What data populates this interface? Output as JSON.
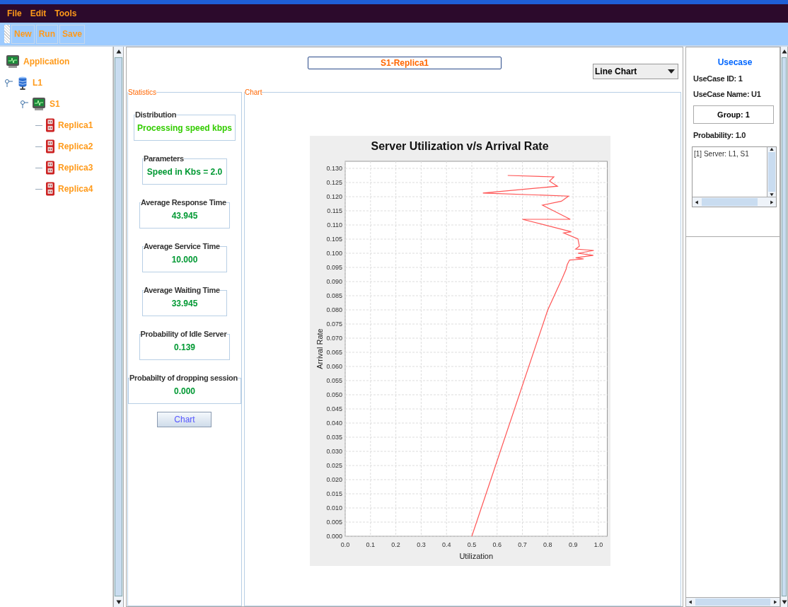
{
  "menu": [
    "File",
    "Edit",
    "Tools"
  ],
  "toolbar": [
    "New",
    "Run",
    "Save"
  ],
  "tree": {
    "label": "Application",
    "kind": "app",
    "children": [
      {
        "label": "L1",
        "kind": "server",
        "expanded": true,
        "children": [
          {
            "label": "S1",
            "kind": "app",
            "expanded": true,
            "children": [
              {
                "label": "Replica1",
                "kind": "replica"
              },
              {
                "label": "Replica2",
                "kind": "replica"
              },
              {
                "label": "Replica3",
                "kind": "replica"
              },
              {
                "label": "Replica4",
                "kind": "replica"
              }
            ]
          }
        ]
      }
    ]
  },
  "selector": {
    "value": "S1-Replica1"
  },
  "chart_type": {
    "value": "Line Chart"
  },
  "statistics": {
    "title": "Statistics",
    "groups": [
      {
        "title": "Distribution",
        "value": "Processing speed kbps",
        "color": "#33cc00"
      },
      {
        "title": "Parameters",
        "value": "Speed in Kbs = 2.0",
        "color": "#009933"
      },
      {
        "title": "Average Response Time",
        "value": "43.945",
        "color": "#009933"
      },
      {
        "title": "Average Service Time",
        "value": "10.000",
        "color": "#009933"
      },
      {
        "title": "Average Waiting Time",
        "value": "33.945",
        "color": "#009933"
      },
      {
        "title": "Probability of Idle Server",
        "value": "0.139",
        "color": "#009933"
      },
      {
        "title": "Probabilty of dropping session",
        "value": "0.000",
        "color": "#009933"
      }
    ],
    "button": "Chart"
  },
  "chart_panel": {
    "title": "Chart",
    "chart_data": {
      "type": "line",
      "title": "Server Utilization v/s Arrival Rate",
      "xlabel": "Utilization",
      "ylabel": "Arrival Rate",
      "x": [
        0.5,
        0.8,
        0.858,
        0.872,
        0.877,
        0.886,
        0.942,
        0.91,
        0.98,
        0.919,
        0.982,
        0.91,
        0.925,
        0.919,
        0.863,
        0.893,
        0.7,
        0.889,
        0.779,
        0.854,
        0.882,
        0.544,
        0.838,
        0.807,
        0.824,
        0.642
      ],
      "series": [
        {
          "color": "#ff5555",
          "values": [
            0,
            0.08,
            0.0913,
            0.0943,
            0.096,
            0.0976,
            0.098,
            0.0984,
            0.0993,
            0.1,
            0.101,
            0.1015,
            0.1025,
            0.1051,
            0.1072,
            0.1076,
            0.112,
            0.112,
            0.117,
            0.1184,
            0.1202,
            0.1213,
            0.1237,
            0.1255,
            0.127,
            0.1275
          ]
        }
      ],
      "xlim": [
        0,
        1.035
      ],
      "ylim": [
        0,
        0.1325
      ],
      "grid": true,
      "xticks": [
        {
          "value": 0,
          "label": "0.0"
        },
        {
          "value": 0.1,
          "label": "0.1"
        },
        {
          "value": 0.2,
          "label": "0.2"
        },
        {
          "value": 0.3,
          "label": "0.3"
        },
        {
          "value": 0.4,
          "label": "0.4"
        },
        {
          "value": 0.5,
          "label": "0.5"
        },
        {
          "value": 0.6,
          "label": "0.6"
        },
        {
          "value": 0.7,
          "label": "0.7"
        },
        {
          "value": 0.8,
          "label": "0.8"
        },
        {
          "value": 0.9,
          "label": "0.9"
        },
        {
          "value": 1,
          "label": "1.0"
        }
      ],
      "yticks": [
        {
          "value": 0,
          "label": "0.000"
        },
        {
          "value": 0.005,
          "label": "0.005"
        },
        {
          "value": 0.01,
          "label": "0.010"
        },
        {
          "value": 0.015,
          "label": "0.015"
        },
        {
          "value": 0.02,
          "label": "0.020"
        },
        {
          "value": 0.025,
          "label": "0.025"
        },
        {
          "value": 0.03,
          "label": "0.030"
        },
        {
          "value": 0.035,
          "label": "0.035"
        },
        {
          "value": 0.04,
          "label": "0.040"
        },
        {
          "value": 0.045,
          "label": "0.045"
        },
        {
          "value": 0.05,
          "label": "0.050"
        },
        {
          "value": 0.055,
          "label": "0.055"
        },
        {
          "value": 0.06,
          "label": "0.060"
        },
        {
          "value": 0.065,
          "label": "0.065"
        },
        {
          "value": 0.07,
          "label": "0.070"
        },
        {
          "value": 0.075,
          "label": "0.075"
        },
        {
          "value": 0.08,
          "label": "0.080"
        },
        {
          "value": 0.085,
          "label": "0.085"
        },
        {
          "value": 0.09,
          "label": "0.090"
        },
        {
          "value": 0.095,
          "label": "0.095"
        },
        {
          "value": 0.1,
          "label": "0.100"
        },
        {
          "value": 0.105,
          "label": "0.105"
        },
        {
          "value": 0.11,
          "label": "0.110"
        },
        {
          "value": 0.115,
          "label": "0.115"
        },
        {
          "value": 0.12,
          "label": "0.120"
        },
        {
          "value": 0.125,
          "label": "0.125"
        },
        {
          "value": 0.13,
          "label": "0.130"
        }
      ]
    }
  },
  "usecase": {
    "title": "Usecase",
    "id": "UseCase ID: 1",
    "name": "UseCase Name: U1",
    "group": "Group: 1",
    "probability": "Probability: 1.0",
    "list": [
      "[1] Server: L1, S1"
    ]
  }
}
